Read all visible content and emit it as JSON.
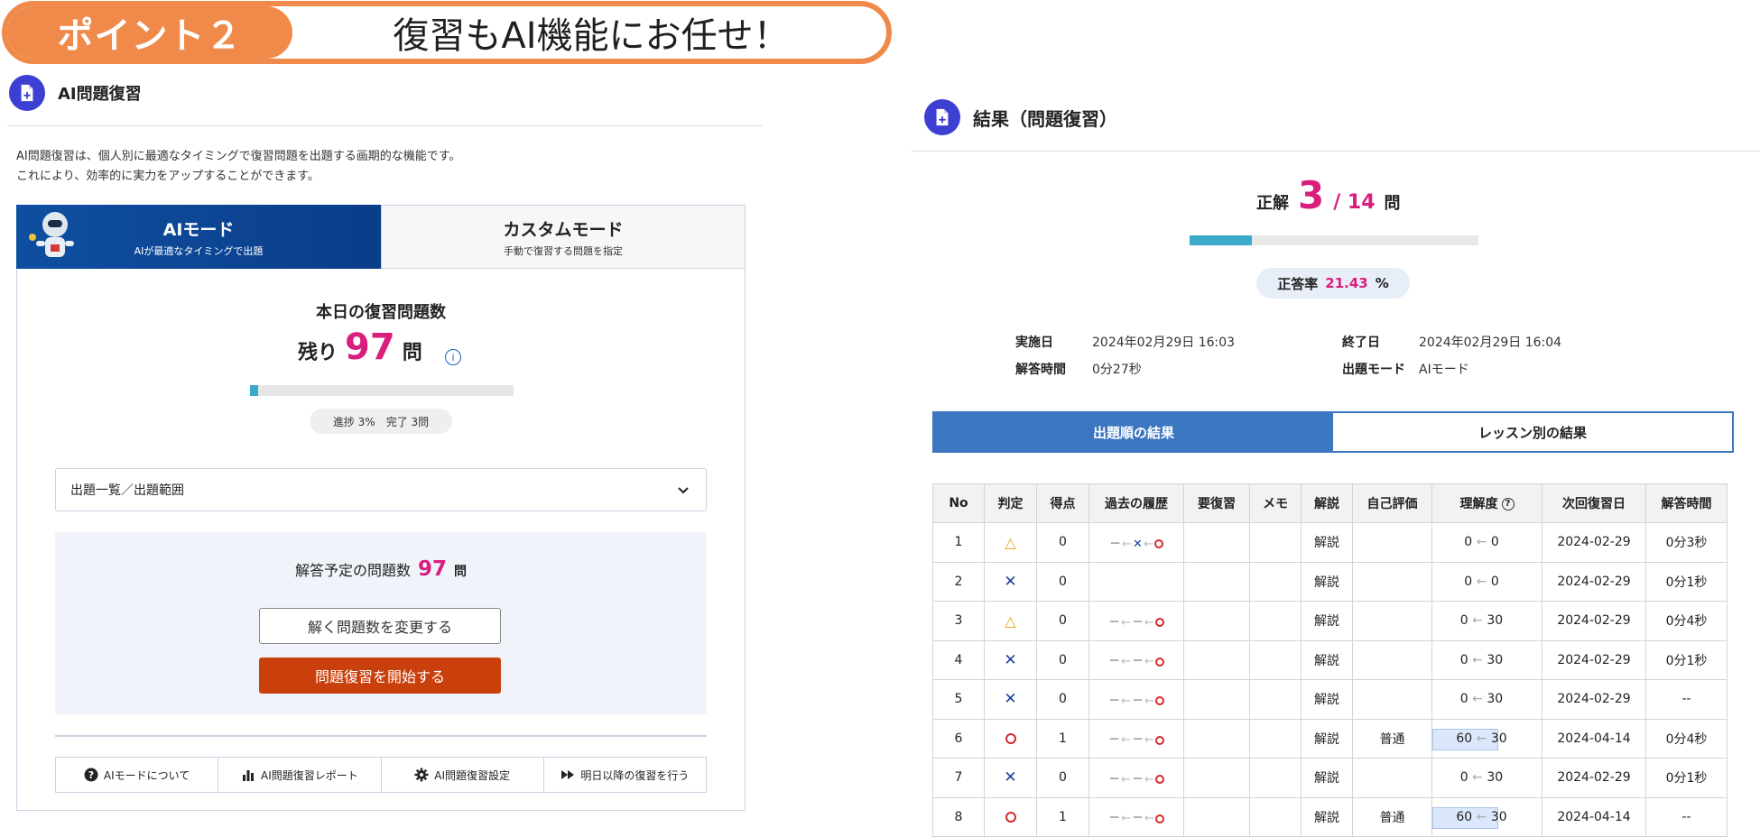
{
  "banner": {
    "tag": "ポイント２",
    "title": "復習もAI機能にお任せ！"
  },
  "left": {
    "title": "AI問題復習",
    "intro_line1": "AI問題復習は、個人別に最適なタイミングで復習問題を出題する画期的な機能です。",
    "intro_line2": "これにより、効率的に実力をアップすることができます。",
    "tab_ai": {
      "label": "AIモード",
      "sub": "AIが最適なタイミングで出題"
    },
    "tab_custom": {
      "label": "カスタムモード",
      "sub": "手動で復習する問題を指定"
    },
    "today_title": "本日の復習問題数",
    "remain_label": "残り",
    "remain_value": "97",
    "remain_unit": "問",
    "progress_fraction": 0.03,
    "progress_text": "進捗 3%　完了 3問",
    "range_label": "出題一覧／出題範囲",
    "plan_label": "解答予定の問題数",
    "plan_value": "97",
    "plan_unit": "問",
    "change_button": "解く問題数を変更する",
    "start_button": "問題復習を開始する",
    "bottom_links": [
      {
        "icon": "question-circle-icon",
        "label": "AIモードについて"
      },
      {
        "icon": "bar-chart-icon",
        "label": "AI問題復習レポート"
      },
      {
        "icon": "gear-icon",
        "label": "AI問題復習設定"
      },
      {
        "icon": "fast-forward-icon",
        "label": "明日以降の復習を行う"
      }
    ]
  },
  "right": {
    "title": "結果（問題復習）",
    "score_label": "正解",
    "correct": "3",
    "total": "/ 14",
    "score_unit": "問",
    "score_fraction": 0.2143,
    "rate_label": "正答率",
    "rate_value": "21.43",
    "rate_unit": "%",
    "meta": {
      "date_label": "実施日",
      "date_value": "2024年02月29日 16:03",
      "end_label": "終了日",
      "end_value": "2024年02月29日 16:04",
      "time_label": "解答時間",
      "time_value": "0分27秒",
      "mode_label": "出題モード",
      "mode_value": "AIモード"
    },
    "tab_order": "出題順の結果",
    "tab_lesson": "レッスン別の結果",
    "columns": [
      "No",
      "判定",
      "得点",
      "過去の履歴",
      "要復習",
      "メモ",
      "解説",
      "自己評価",
      "理解度",
      "次回復習日",
      "解答時間"
    ],
    "rows": [
      {
        "no": "1",
        "judge": "tri",
        "score": "0",
        "history": "x-o",
        "link": "解説",
        "self": "",
        "und_new": "0",
        "und_old": "0",
        "und_fill": 0,
        "next": "2024-02-29",
        "time": "0分3秒"
      },
      {
        "no": "2",
        "judge": "x",
        "score": "0",
        "history": "none",
        "link": "解説",
        "self": "",
        "und_new": "0",
        "und_old": "0",
        "und_fill": 0,
        "next": "2024-02-29",
        "time": "0分1秒"
      },
      {
        "no": "3",
        "judge": "tri",
        "score": "0",
        "history": "o",
        "link": "解説",
        "self": "",
        "und_new": "0",
        "und_old": "30",
        "und_fill": 0,
        "next": "2024-02-29",
        "time": "0分4秒"
      },
      {
        "no": "4",
        "judge": "x",
        "score": "0",
        "history": "o",
        "link": "解説",
        "self": "",
        "und_new": "0",
        "und_old": "30",
        "und_fill": 0,
        "next": "2024-02-29",
        "time": "0分1秒"
      },
      {
        "no": "5",
        "judge": "x",
        "score": "0",
        "history": "o",
        "link": "解説",
        "self": "",
        "und_new": "0",
        "und_old": "30",
        "und_fill": 0,
        "next": "2024-02-29",
        "time": "--"
      },
      {
        "no": "6",
        "judge": "o",
        "score": "1",
        "history": "o",
        "link": "解説",
        "self": "普通",
        "und_new": "60",
        "und_old": "30",
        "und_fill": 0.6,
        "next": "2024-04-14",
        "time": "0分4秒"
      },
      {
        "no": "7",
        "judge": "x",
        "score": "0",
        "history": "o",
        "link": "解説",
        "self": "",
        "und_new": "0",
        "und_old": "30",
        "und_fill": 0,
        "next": "2024-02-29",
        "time": "0分1秒"
      },
      {
        "no": "8",
        "judge": "o",
        "score": "1",
        "history": "o",
        "link": "解説",
        "self": "普通",
        "und_new": "60",
        "und_old": "30",
        "und_fill": 0.6,
        "next": "2024-04-14",
        "time": "--"
      }
    ]
  }
}
